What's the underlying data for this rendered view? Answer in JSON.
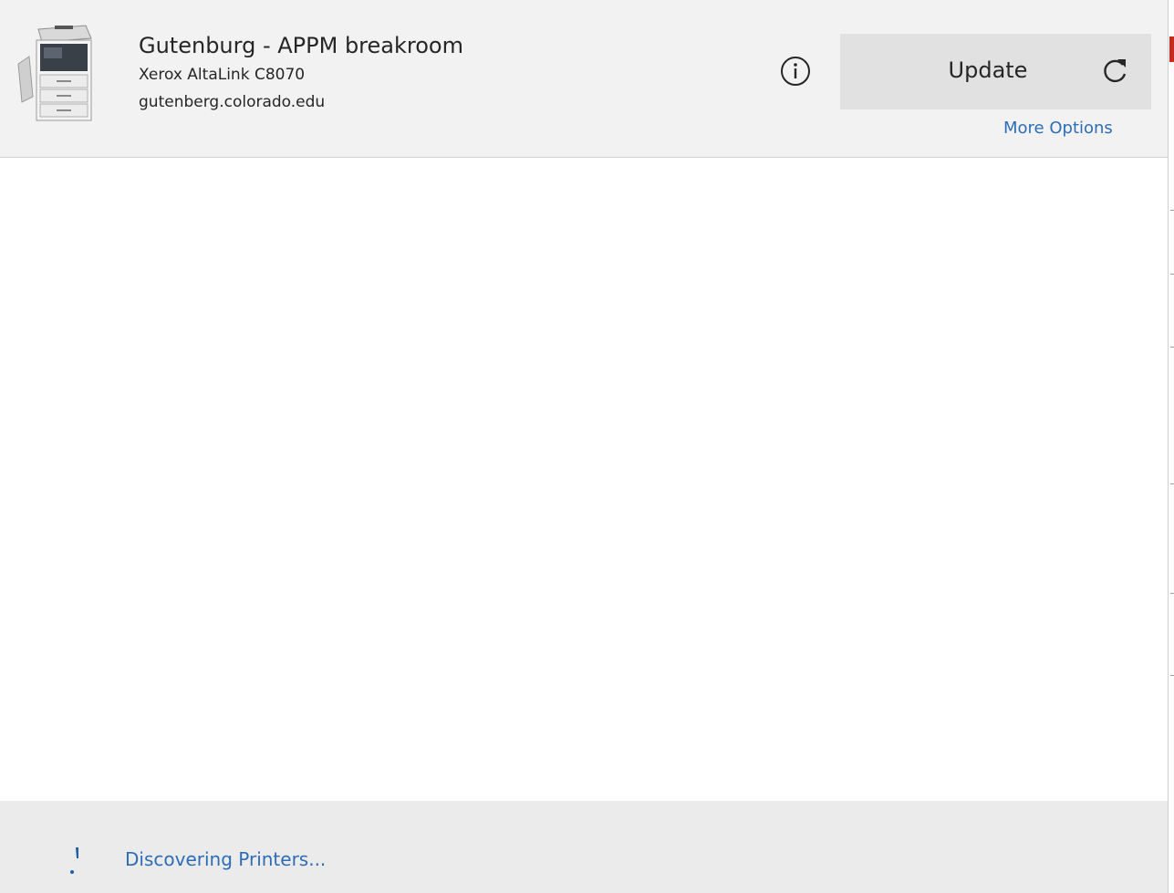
{
  "printer": {
    "name": "Gutenburg - APPM breakroom",
    "model": "Xerox AltaLink C8070",
    "host": "gutenberg.colorado.edu"
  },
  "actions": {
    "info_icon": "info-icon",
    "update_label": "Update",
    "refresh_icon": "refresh-icon",
    "more_options_label": "More Options"
  },
  "footer": {
    "status_text": "Discovering Printers...",
    "spinner_icon": "loading-spinner-icon"
  },
  "colors": {
    "header_bg": "#f2f2f2",
    "button_bg": "#e1e1e1",
    "link": "#2d6db5",
    "footer_bg": "#ebebeb",
    "text": "#262626"
  }
}
